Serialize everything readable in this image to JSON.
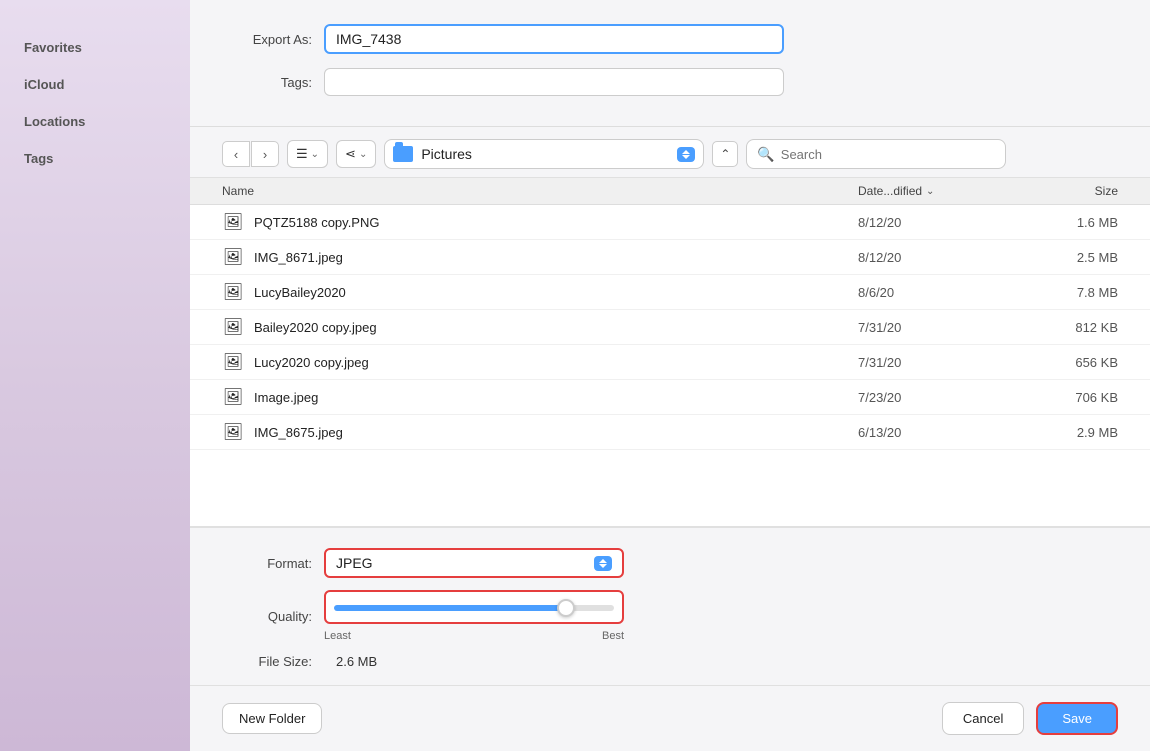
{
  "sidebar": {
    "sections": [
      {
        "label": "Favorites",
        "items": []
      },
      {
        "label": "iCloud",
        "items": []
      },
      {
        "label": "Locations",
        "items": []
      },
      {
        "label": "Tags",
        "items": []
      }
    ]
  },
  "form": {
    "export_as_label": "Export As:",
    "export_as_value": "IMG_7438",
    "tags_label": "Tags:",
    "tags_placeholder": ""
  },
  "toolbar": {
    "location_name": "Pictures",
    "search_placeholder": "Search"
  },
  "file_list": {
    "columns": {
      "name": "Name",
      "date": "Date...dified",
      "size": "Size"
    },
    "files": [
      {
        "icon": "🖼",
        "name": "PQTZ5188 copy.PNG",
        "date": "8/12/20",
        "size": "1.6 MB"
      },
      {
        "icon": "🖼",
        "name": "IMG_8671.jpeg",
        "date": "8/12/20",
        "size": "2.5 MB"
      },
      {
        "icon": "🖼",
        "name": "LucyBailey2020",
        "date": "8/6/20",
        "size": "7.8 MB"
      },
      {
        "icon": "🖼",
        "name": "Bailey2020 copy.jpeg",
        "date": "7/31/20",
        "size": "812 KB"
      },
      {
        "icon": "🖼",
        "name": "Lucy2020 copy.jpeg",
        "date": "7/31/20",
        "size": "656 KB"
      },
      {
        "icon": "🖼",
        "name": "Image.jpeg",
        "date": "7/23/20",
        "size": "706 KB"
      },
      {
        "icon": "🖼",
        "name": "IMG_8675.jpeg",
        "date": "6/13/20",
        "size": "2.9 MB"
      }
    ]
  },
  "options": {
    "format_label": "Format:",
    "format_value": "JPEG",
    "quality_label": "Quality:",
    "quality_least": "Least",
    "quality_best": "Best",
    "quality_value": 85,
    "filesize_label": "File Size:",
    "filesize_value": "2.6 MB"
  },
  "footer": {
    "new_folder": "New Folder",
    "cancel": "Cancel",
    "save": "Save"
  }
}
